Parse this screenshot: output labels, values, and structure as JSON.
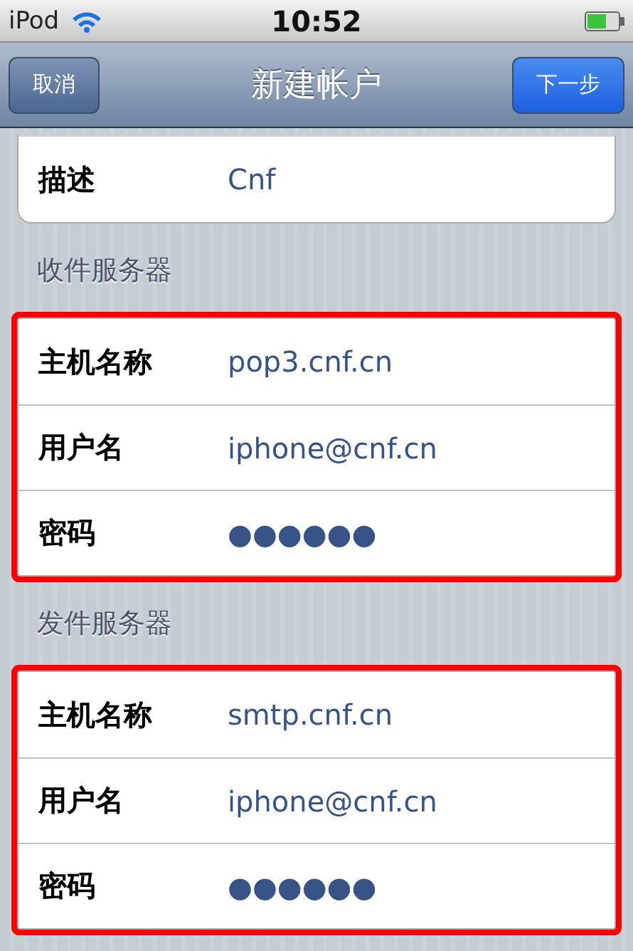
{
  "status_bar": {
    "carrier": "iPod",
    "time": "10:52"
  },
  "nav_bar": {
    "left_button": "取消",
    "title": "新建帐户",
    "right_button": "下一步"
  },
  "top_group": {
    "rows": [
      {
        "label": "描述",
        "value": "Cnf"
      }
    ]
  },
  "sections": [
    {
      "header": "收件服务器",
      "highlighted": true,
      "rows": [
        {
          "label": "主机名称",
          "value": "pop3.cnf.cn"
        },
        {
          "label": "用户名",
          "value": "iphone@cnf.cn"
        },
        {
          "label": "密码",
          "value": "●●●●●●"
        }
      ]
    },
    {
      "header": "发件服务器",
      "highlighted": true,
      "rows": [
        {
          "label": "主机名称",
          "value": "smtp.cnf.cn"
        },
        {
          "label": "用户名",
          "value": "iphone@cnf.cn"
        },
        {
          "label": "密码",
          "value": "●●●●●●"
        }
      ]
    }
  ]
}
